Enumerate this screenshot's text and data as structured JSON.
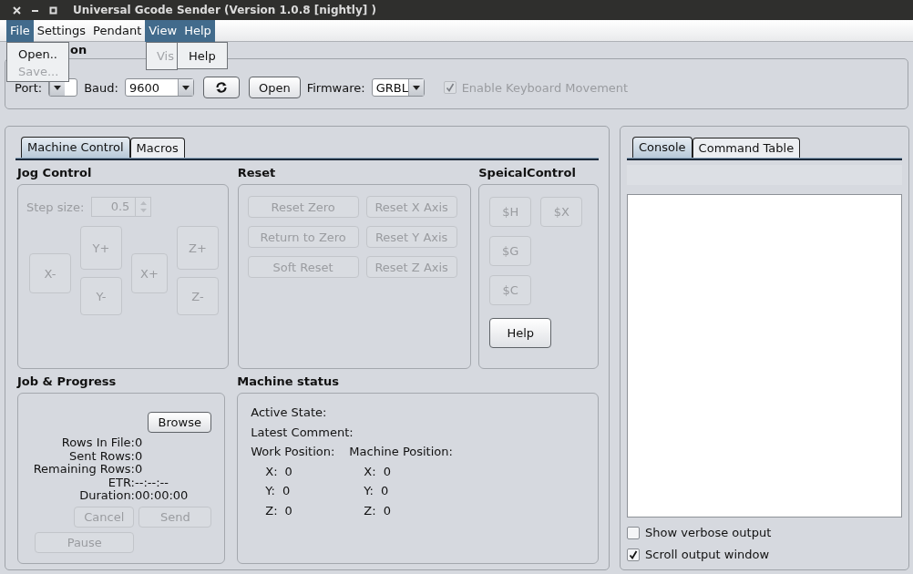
{
  "window": {
    "title": "Universal Gcode Sender (Version 1.0.8 [nightly]  )"
  },
  "menu_bar": [
    {
      "label": "File",
      "selected": true
    },
    {
      "label": "Settings",
      "selected": false
    },
    {
      "label": "Pendant",
      "selected": false
    },
    {
      "label": "View",
      "selected": true
    },
    {
      "label": "Help",
      "selected": true
    }
  ],
  "file_menu": [
    {
      "label": "Open..",
      "disabled": false
    },
    {
      "label": "Save...",
      "disabled": true
    }
  ],
  "view_menu": [
    {
      "label": "Vis",
      "disabled": true
    }
  ],
  "help_menu": [
    {
      "label": "Help",
      "disabled": false
    }
  ],
  "connection": {
    "title": "on",
    "port_label": "Port:",
    "baud_label": "Baud:",
    "baud_value": "9600",
    "open_button": "Open",
    "firmware_label": "Firmware:",
    "firmware_value": "GRBL",
    "keyboard_movement": {
      "label": "Enable Keyboard Movement",
      "checked": true,
      "disabled": true
    }
  },
  "left_tabs": [
    {
      "label": "Machine Control",
      "selected": true
    },
    {
      "label": "Macros",
      "selected": false
    }
  ],
  "jog_control": {
    "title": "Jog Control",
    "step_label": "Step size:",
    "step_value": "0.5",
    "disabled": true,
    "buttons": [
      {
        "label": "Y+",
        "disabled": true
      },
      {
        "label": "Z+",
        "disabled": true
      },
      {
        "label": "X-",
        "disabled": true
      },
      {
        "label": "X+",
        "disabled": true
      },
      {
        "label": "Y-",
        "disabled": true
      },
      {
        "label": "Z-",
        "disabled": true
      }
    ]
  },
  "reset": {
    "title": "Reset",
    "buttons": [
      {
        "label": "Reset Zero",
        "disabled": true
      },
      {
        "label": "Reset X Axis",
        "disabled": true
      },
      {
        "label": "Return to Zero",
        "disabled": true
      },
      {
        "label": "Reset Y Axis",
        "disabled": true
      },
      {
        "label": "Soft Reset",
        "disabled": true
      },
      {
        "label": "Reset Z Axis",
        "disabled": true
      }
    ]
  },
  "special_control": {
    "title": "SpeicalControl",
    "buttons": [
      {
        "label": "$H",
        "disabled": true
      },
      {
        "label": "$X",
        "disabled": true
      },
      {
        "label": "$G",
        "disabled": true
      },
      {
        "label": "$C",
        "disabled": true
      },
      {
        "label": "Help",
        "disabled": false
      }
    ]
  },
  "job_progress": {
    "title": "Job & Progress",
    "browse_button": "Browse",
    "stats": [
      {
        "label": "Rows In File:",
        "value": "0"
      },
      {
        "label": "Sent Rows:",
        "value": "0"
      },
      {
        "label": "Remaining Rows:",
        "value": "0"
      },
      {
        "label": "ETR:",
        "value": "--:--:--"
      },
      {
        "label": "Duration:",
        "value": "00:00:00"
      }
    ],
    "buttons": [
      {
        "label": "Cancel",
        "disabled": true
      },
      {
        "label": "Send",
        "disabled": true
      },
      {
        "label": "Pause",
        "disabled": true
      }
    ]
  },
  "machine_status": {
    "title": "Machine status",
    "active_state_label": "Active State:",
    "latest_comment_label": "Latest Comment:",
    "work_position_label": "Work Position:",
    "machine_position_label": "Machine Position:",
    "work_position": [
      {
        "axis": "X:",
        "value": "0"
      },
      {
        "axis": "Y:",
        "value": "0"
      },
      {
        "axis": "Z:",
        "value": "0"
      }
    ],
    "machine_position": [
      {
        "axis": "X:",
        "value": "0"
      },
      {
        "axis": "Y:",
        "value": "0"
      },
      {
        "axis": "Z:",
        "value": "0"
      }
    ]
  },
  "right_tabs": [
    {
      "label": "Console",
      "selected": true
    },
    {
      "label": "Command Table",
      "selected": false
    }
  ],
  "console_options": [
    {
      "label": "Show verbose output",
      "checked": false
    },
    {
      "label": "Scroll output window",
      "checked": true
    }
  ]
}
